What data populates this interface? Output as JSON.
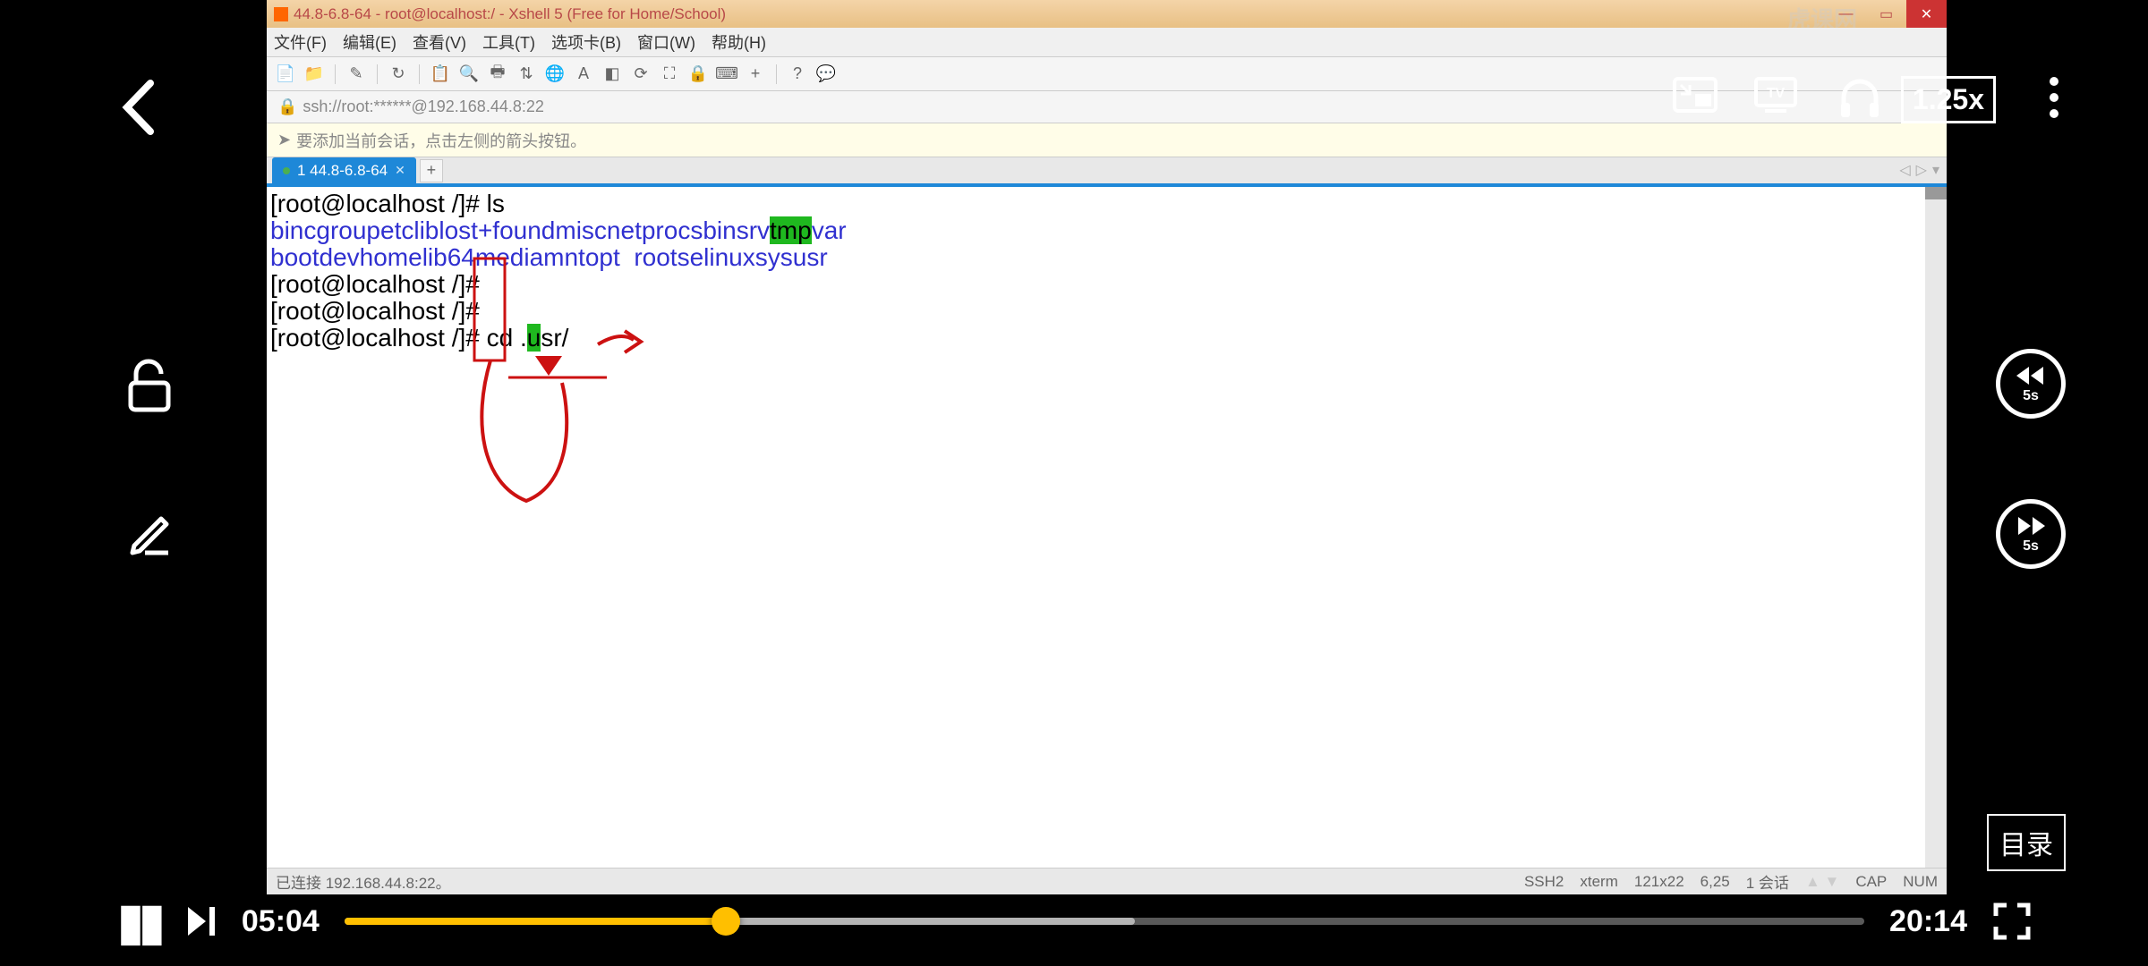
{
  "xshell": {
    "title": "44.8-6.8-64 - root@localhost:/ - Xshell 5 (Free for Home/School)",
    "menus": [
      "文件(F)",
      "编辑(E)",
      "查看(V)",
      "工具(T)",
      "选项卡(B)",
      "窗口(W)",
      "帮助(H)"
    ],
    "address": "ssh://root:******@192.168.44.8:22",
    "hint": "要添加当前会话，点击左侧的箭头按钮。",
    "tab": {
      "label": "1 44.8-6.8-64"
    },
    "terminal": {
      "prompt": "[root@localhost /]#",
      "cmd_ls": "ls",
      "row1": [
        {
          "t": "bin",
          "c": "dir"
        },
        {
          "t": "cgroup",
          "c": "dir"
        },
        {
          "t": "etc",
          "c": "dir"
        },
        {
          "t": "lib",
          "c": "dir"
        },
        {
          "t": "lost+found",
          "c": "dir"
        },
        {
          "t": "misc",
          "c": "dir"
        },
        {
          "t": "net",
          "c": "dir"
        },
        {
          "t": "proc",
          "c": "dir"
        },
        {
          "t": "sbin",
          "c": "dir"
        },
        {
          "t": "srv",
          "c": "dir"
        },
        {
          "t": "tmp",
          "c": "hl"
        },
        {
          "t": "var",
          "c": "dir"
        }
      ],
      "row2": [
        {
          "t": "boot",
          "c": "dir"
        },
        {
          "t": "dev",
          "c": "dir"
        },
        {
          "t": "home",
          "c": "dir"
        },
        {
          "t": "lib64",
          "c": "dir"
        },
        {
          "t": "media",
          "c": "dir"
        },
        {
          "t": "mnt",
          "c": "dir"
        },
        {
          "t": "opt",
          "c": "dir"
        },
        {
          "t": "root",
          "c": "dir"
        },
        {
          "t": "selinux",
          "c": "dir"
        },
        {
          "t": "sys",
          "c": "dir"
        },
        {
          "t": "usr",
          "c": "dir"
        }
      ],
      "cmd_cd": "cd .usr/",
      "cols": [
        0,
        9,
        21,
        30,
        40,
        54,
        72,
        85,
        94,
        107,
        119,
        128,
        137
      ]
    },
    "status": {
      "left": "已连接 192.168.44.8:22。",
      "items": [
        "SSH2",
        "xterm",
        "121x22",
        "6,25",
        "1 会话",
        "CAP",
        "NUM"
      ]
    }
  },
  "player": {
    "current": "05:04",
    "total": "20:14",
    "speed": "1.25x",
    "toc": "目录",
    "skip_back": "5s",
    "skip_fwd": "5s",
    "progress_pct": 25.1,
    "buffer_pct": 52
  }
}
